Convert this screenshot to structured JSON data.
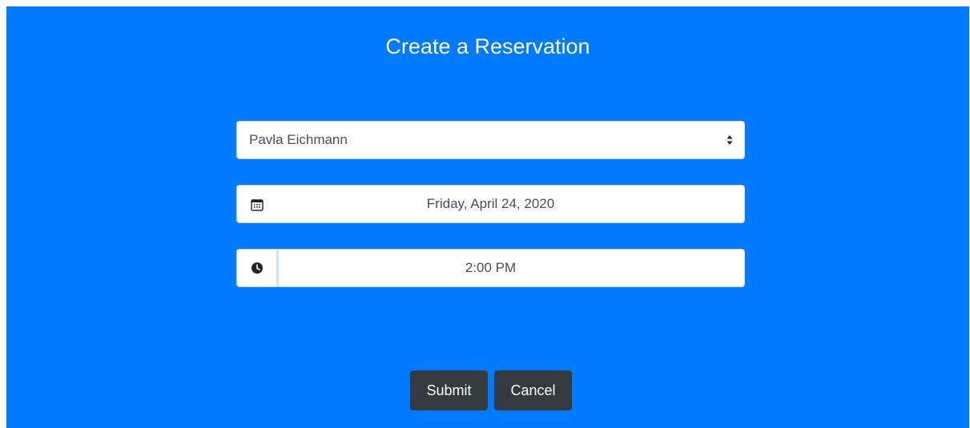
{
  "header": {
    "title": "Create a Reservation"
  },
  "form": {
    "guest_select": {
      "selected": "Pavla Eichmann",
      "icon": "select-arrows-icon"
    },
    "date_field": {
      "value": "Friday, April 24, 2020",
      "icon": "calendar-icon"
    },
    "time_field": {
      "value": "2:00 PM",
      "icon": "clock-icon"
    }
  },
  "actions": {
    "submit_label": "Submit",
    "cancel_label": "Cancel"
  },
  "colors": {
    "panel_background": "#007bff",
    "button_background": "#343a40",
    "text_white": "#ffffff",
    "field_text": "#495057"
  }
}
